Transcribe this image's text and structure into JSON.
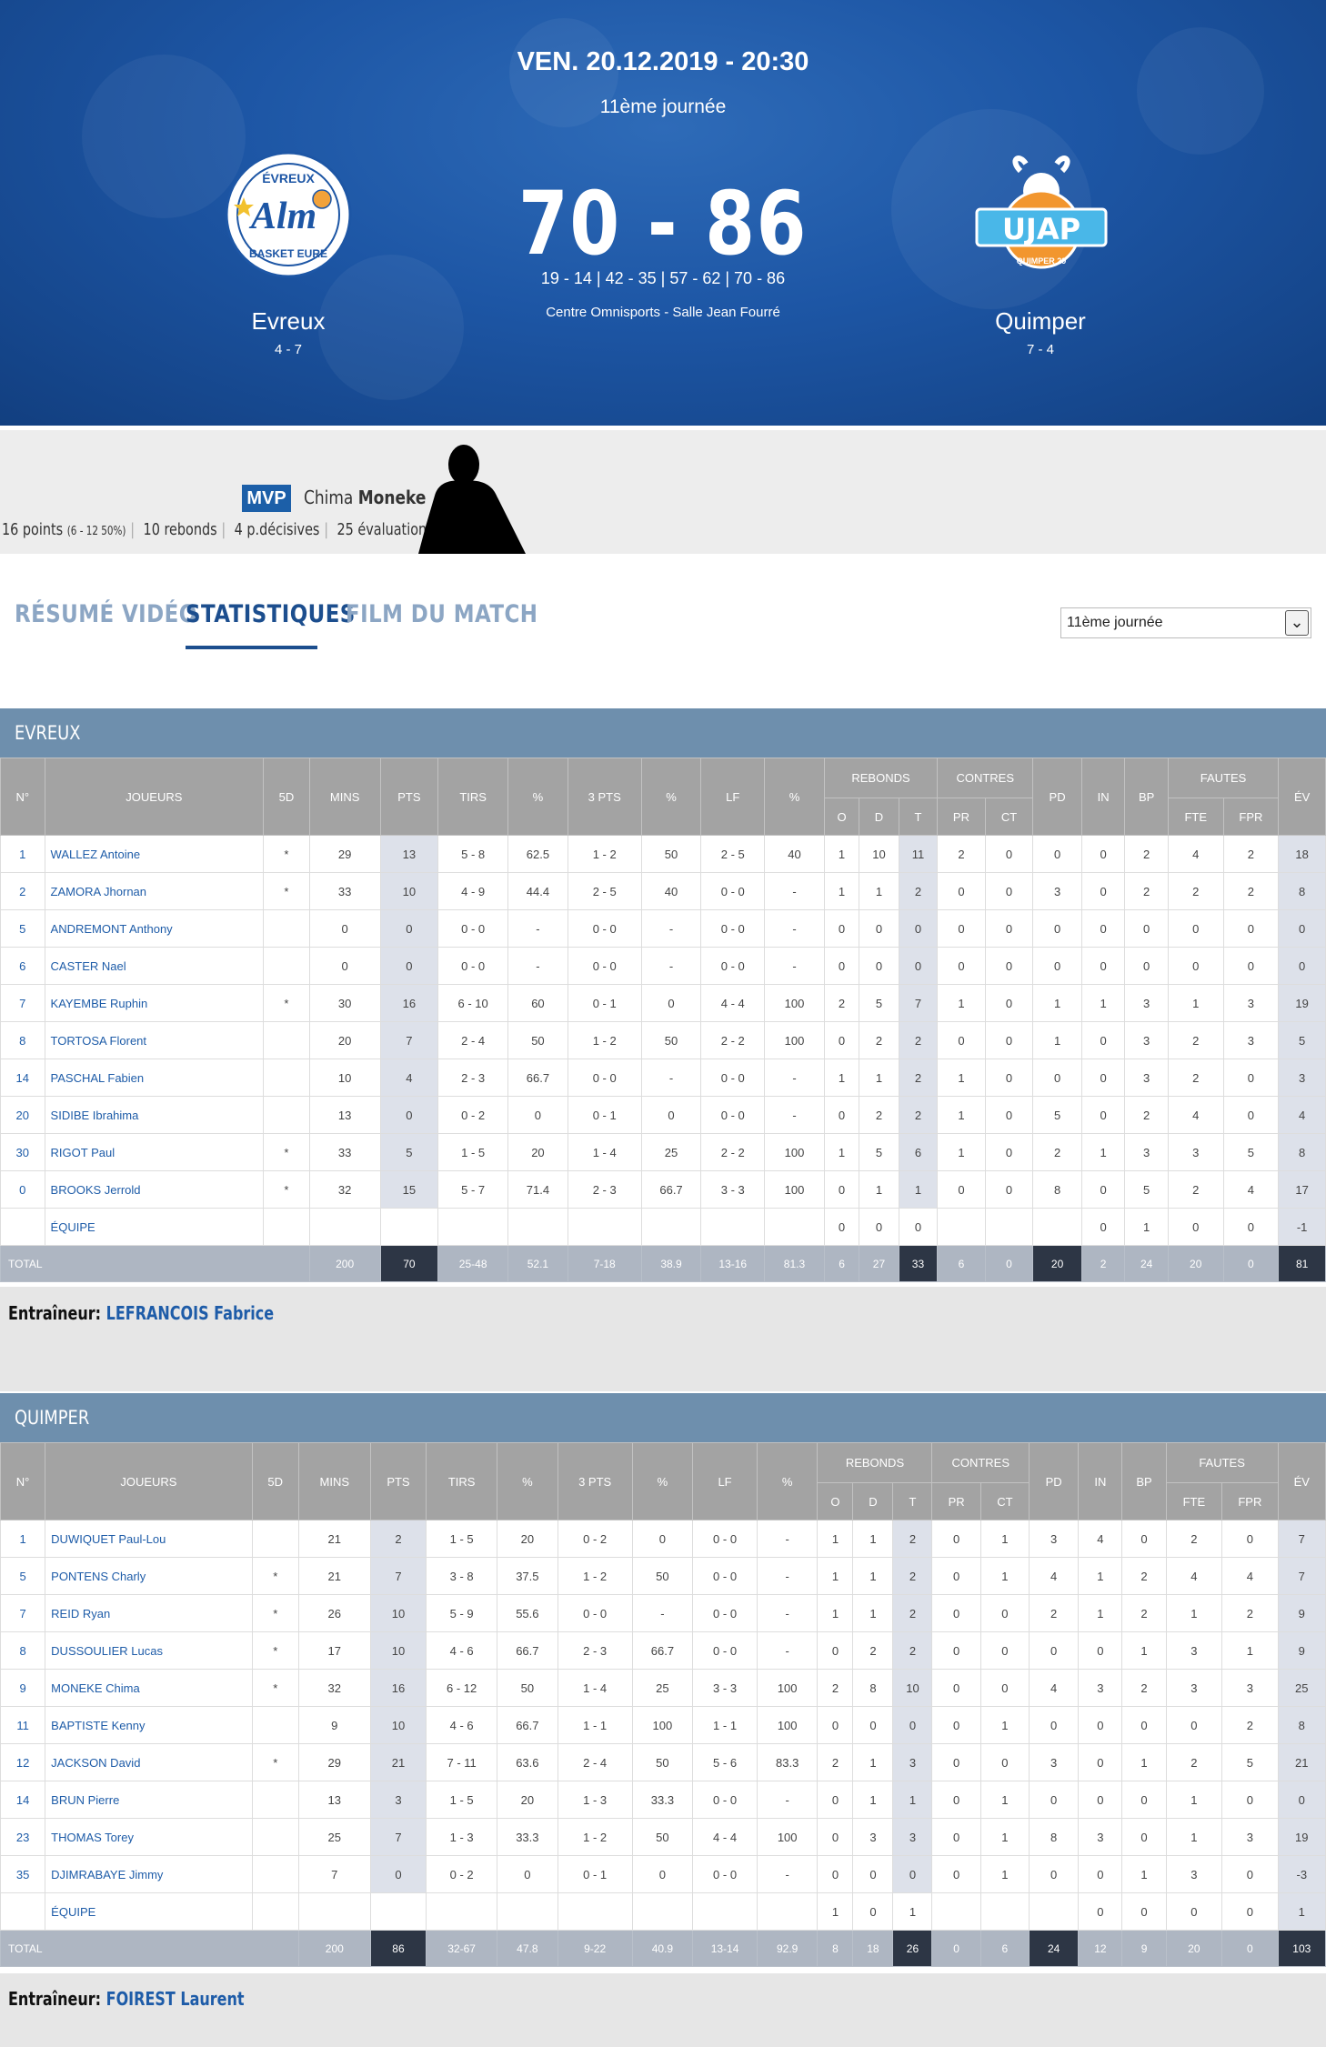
{
  "match": {
    "date": "VEN. 20.12.2019 - 20:30",
    "round": "11ème journée",
    "score": "70 - 86",
    "quarters": "19 - 14 | 42 - 35 | 57 - 62 | 70 - 86",
    "venue": "Centre Omnisports - Salle Jean Fourré",
    "home": {
      "name": "Evreux",
      "record": "4 - 7",
      "logo_text_top": "ÉVREUX",
      "logo_text_mid": "Alm",
      "logo_text_bottom": "BASKET EURE"
    },
    "away": {
      "name": "Quimper",
      "record": "7 - 4",
      "logo_text_mid": "UJAP",
      "logo_text_bottom": "QUIMPER 29"
    }
  },
  "mvp": {
    "badge": "MVP",
    "first_name": "Chima",
    "last_name": "Moneke",
    "points": "16 points",
    "shooting": "(6 - 12 50%)",
    "rebounds": "10 rebonds",
    "assists": "4 p.décisives",
    "evaluation": "25 évaluation"
  },
  "tabs": [
    {
      "label": "RÉSUMÉ VIDÉO",
      "active": false
    },
    {
      "label": "STATISTIQUES",
      "active": true
    },
    {
      "label": "FILM DU MATCH",
      "active": false
    }
  ],
  "round_select": {
    "value": "11ème journée"
  },
  "columns": {
    "num": "N°",
    "players": "JOUEURS",
    "five": "5D",
    "mins": "MINS",
    "pts": "PTS",
    "tirs": "TIRS",
    "pct": "%",
    "three": "3 PTS",
    "lf": "LF",
    "rebonds": "REBONDS",
    "o": "O",
    "d": "D",
    "t": "T",
    "contres": "CONTRES",
    "pr": "PR",
    "ct": "CT",
    "pd": "PD",
    "in": "IN",
    "bp": "BP",
    "fautes": "FAUTES",
    "fte": "FTE",
    "fpr": "FPR",
    "ev": "ÉV"
  },
  "teams": [
    {
      "header": "EVREUX",
      "players": [
        [
          "1",
          "WALLEZ Antoine",
          "*",
          "29",
          "13",
          "5 - 8",
          "62.5",
          "1 - 2",
          "50",
          "2 - 5",
          "40",
          "1",
          "10",
          "11",
          "2",
          "0",
          "0",
          "0",
          "2",
          "4",
          "2",
          "18"
        ],
        [
          "2",
          "ZAMORA Jhornan",
          "*",
          "33",
          "10",
          "4 - 9",
          "44.4",
          "2 - 5",
          "40",
          "0 - 0",
          "-",
          "1",
          "1",
          "2",
          "0",
          "0",
          "3",
          "0",
          "2",
          "2",
          "2",
          "8"
        ],
        [
          "5",
          "ANDREMONT Anthony",
          "",
          "0",
          "0",
          "0 - 0",
          "-",
          "0 - 0",
          "-",
          "0 - 0",
          "-",
          "0",
          "0",
          "0",
          "0",
          "0",
          "0",
          "0",
          "0",
          "0",
          "0",
          "0"
        ],
        [
          "6",
          "CASTER Nael",
          "",
          "0",
          "0",
          "0 - 0",
          "-",
          "0 - 0",
          "-",
          "0 - 0",
          "-",
          "0",
          "0",
          "0",
          "0",
          "0",
          "0",
          "0",
          "0",
          "0",
          "0",
          "0"
        ],
        [
          "7",
          "KAYEMBE Ruphin",
          "*",
          "30",
          "16",
          "6 - 10",
          "60",
          "0 - 1",
          "0",
          "4 - 4",
          "100",
          "2",
          "5",
          "7",
          "1",
          "0",
          "1",
          "1",
          "3",
          "1",
          "3",
          "19"
        ],
        [
          "8",
          "TORTOSA Florent",
          "",
          "20",
          "7",
          "2 - 4",
          "50",
          "1 - 2",
          "50",
          "2 - 2",
          "100",
          "0",
          "2",
          "2",
          "0",
          "0",
          "1",
          "0",
          "3",
          "2",
          "3",
          "5"
        ],
        [
          "14",
          "PASCHAL Fabien",
          "",
          "10",
          "4",
          "2 - 3",
          "66.7",
          "0 - 0",
          "-",
          "0 - 0",
          "-",
          "1",
          "1",
          "2",
          "1",
          "0",
          "0",
          "0",
          "3",
          "2",
          "0",
          "3"
        ],
        [
          "20",
          "SIDIBE Ibrahima",
          "",
          "13",
          "0",
          "0 - 2",
          "0",
          "0 - 1",
          "0",
          "0 - 0",
          "-",
          "0",
          "2",
          "2",
          "1",
          "0",
          "5",
          "0",
          "2",
          "4",
          "0",
          "4"
        ],
        [
          "30",
          "RIGOT Paul",
          "*",
          "33",
          "5",
          "1 - 5",
          "20",
          "1 - 4",
          "25",
          "2 - 2",
          "100",
          "1",
          "5",
          "6",
          "1",
          "0",
          "2",
          "1",
          "3",
          "3",
          "5",
          "8"
        ],
        [
          "0",
          "BROOKS Jerrold",
          "*",
          "32",
          "15",
          "5 - 7",
          "71.4",
          "2 - 3",
          "66.7",
          "3 - 3",
          "100",
          "0",
          "1",
          "1",
          "0",
          "0",
          "8",
          "0",
          "5",
          "2",
          "4",
          "17"
        ]
      ],
      "team_row": [
        "",
        "ÉQUIPE",
        "",
        "",
        "",
        "",
        "",
        "",
        "",
        "",
        "",
        "0",
        "0",
        "0",
        "",
        "",
        "",
        "0",
        "1",
        "0",
        "0",
        "-1"
      ],
      "total": [
        "TOTAL",
        "200",
        "70",
        "25-48",
        "52.1",
        "7-18",
        "38.9",
        "13-16",
        "81.3",
        "6",
        "27",
        "33",
        "6",
        "0",
        "20",
        "2",
        "24",
        "20",
        "0",
        "81"
      ],
      "coach_label": "Entraîneur:",
      "coach": "LEFRANCOIS Fabrice"
    },
    {
      "header": "QUIMPER",
      "players": [
        [
          "1",
          "DUWIQUET Paul-Lou",
          "",
          "21",
          "2",
          "1 - 5",
          "20",
          "0 - 2",
          "0",
          "0 - 0",
          "-",
          "1",
          "1",
          "2",
          "0",
          "1",
          "3",
          "4",
          "0",
          "2",
          "0",
          "7"
        ],
        [
          "5",
          "PONTENS Charly",
          "*",
          "21",
          "7",
          "3 - 8",
          "37.5",
          "1 - 2",
          "50",
          "0 - 0",
          "-",
          "1",
          "1",
          "2",
          "0",
          "1",
          "4",
          "1",
          "2",
          "4",
          "4",
          "7"
        ],
        [
          "7",
          "REID Ryan",
          "*",
          "26",
          "10",
          "5 - 9",
          "55.6",
          "0 - 0",
          "-",
          "0 - 0",
          "-",
          "1",
          "1",
          "2",
          "0",
          "0",
          "2",
          "1",
          "2",
          "1",
          "2",
          "9"
        ],
        [
          "8",
          "DUSSOULIER Lucas",
          "*",
          "17",
          "10",
          "4 - 6",
          "66.7",
          "2 - 3",
          "66.7",
          "0 - 0",
          "-",
          "0",
          "2",
          "2",
          "0",
          "0",
          "0",
          "0",
          "1",
          "3",
          "1",
          "9"
        ],
        [
          "9",
          "MONEKE Chima",
          "*",
          "32",
          "16",
          "6 - 12",
          "50",
          "1 - 4",
          "25",
          "3 - 3",
          "100",
          "2",
          "8",
          "10",
          "0",
          "0",
          "4",
          "3",
          "2",
          "3",
          "3",
          "25"
        ],
        [
          "11",
          "BAPTISTE Kenny",
          "",
          "9",
          "10",
          "4 - 6",
          "66.7",
          "1 - 1",
          "100",
          "1 - 1",
          "100",
          "0",
          "0",
          "0",
          "0",
          "1",
          "0",
          "0",
          "0",
          "0",
          "2",
          "8"
        ],
        [
          "12",
          "JACKSON David",
          "*",
          "29",
          "21",
          "7 - 11",
          "63.6",
          "2 - 4",
          "50",
          "5 - 6",
          "83.3",
          "2",
          "1",
          "3",
          "0",
          "0",
          "3",
          "0",
          "1",
          "2",
          "5",
          "21"
        ],
        [
          "14",
          "BRUN Pierre",
          "",
          "13",
          "3",
          "1 - 5",
          "20",
          "1 - 3",
          "33.3",
          "0 - 0",
          "-",
          "0",
          "1",
          "1",
          "0",
          "1",
          "0",
          "0",
          "0",
          "1",
          "0",
          "0"
        ],
        [
          "23",
          "THOMAS Torey",
          "",
          "25",
          "7",
          "1 - 3",
          "33.3",
          "1 - 2",
          "50",
          "4 - 4",
          "100",
          "0",
          "3",
          "3",
          "0",
          "1",
          "8",
          "3",
          "0",
          "1",
          "3",
          "19"
        ],
        [
          "35",
          "DJIMRABAYE Jimmy",
          "",
          "7",
          "0",
          "0 - 2",
          "0",
          "0 - 1",
          "0",
          "0 - 0",
          "-",
          "0",
          "0",
          "0",
          "0",
          "1",
          "0",
          "0",
          "1",
          "3",
          "0",
          "-3"
        ]
      ],
      "team_row": [
        "",
        "ÉQUIPE",
        "",
        "",
        "",
        "",
        "",
        "",
        "",
        "",
        "",
        "1",
        "0",
        "1",
        "",
        "",
        "",
        "0",
        "0",
        "0",
        "0",
        "1"
      ],
      "total": [
        "TOTAL",
        "200",
        "86",
        "32-67",
        "47.8",
        "9-22",
        "40.9",
        "13-14",
        "92.9",
        "8",
        "18",
        "26",
        "0",
        "6",
        "24",
        "12",
        "9",
        "20",
        "0",
        "103"
      ],
      "coach_label": "Entraîneur:",
      "coach": "FOIREST Laurent"
    }
  ],
  "colors": {
    "hero": "#1d56a5",
    "accent": "#1c4e8e",
    "team_header": "#6e8fad",
    "table_header": "#a3a3a3",
    "highlight": "#dde1ea",
    "total_dark": "#2d3645"
  }
}
